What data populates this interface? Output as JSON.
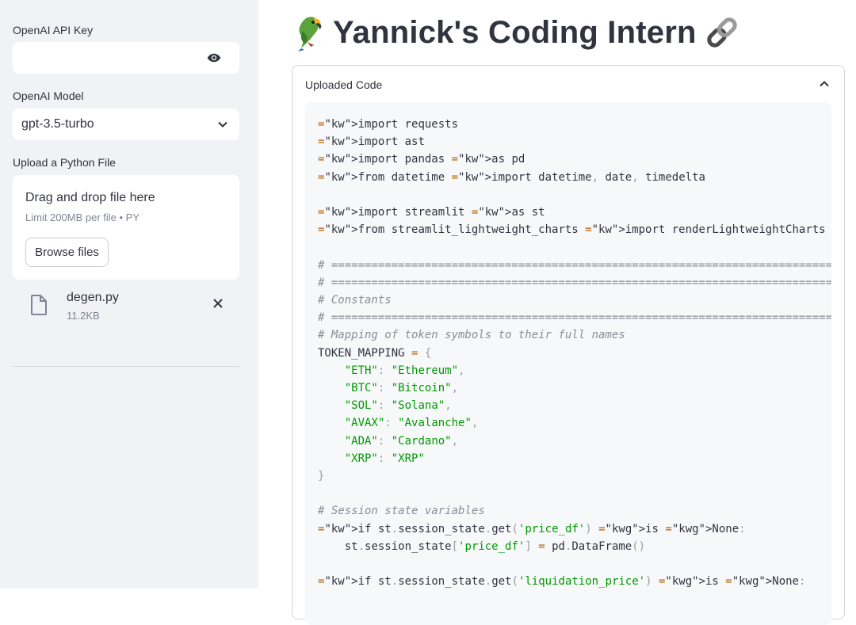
{
  "sidebar": {
    "api_key_label": "OpenAI API Key",
    "api_key_value": "",
    "model_label": "OpenAI Model",
    "model_value": "gpt-3.5-turbo",
    "upload_label": "Upload a Python File",
    "dropzone_title": "Drag and drop file here",
    "dropzone_limit": "Limit 200MB per file • PY",
    "browse_label": "Browse files",
    "file_name": "degen.py",
    "file_size": "11.2KB"
  },
  "main": {
    "title": "Yannick's Coding Intern",
    "title_icon_left": "parrot-icon",
    "title_icon_right": "link-icon",
    "expander_label": "Uploaded Code"
  },
  "code_lines": [
    "import requests",
    "import ast",
    "import pandas as pd",
    "from datetime import datetime, date, timedelta",
    "",
    "import streamlit as st",
    "from streamlit_lightweight_charts import renderLightweightCharts",
    "",
    "# ==========================================================================================",
    "# ==========================================================================================",
    "# Constants",
    "# ==========================================================================================",
    "# Mapping of token symbols to their full names",
    "TOKEN_MAPPING = {",
    "    \"ETH\": \"Ethereum\",",
    "    \"BTC\": \"Bitcoin\",",
    "    \"SOL\": \"Solana\",",
    "    \"AVAX\": \"Avalanche\",",
    "    \"ADA\": \"Cardano\",",
    "    \"XRP\": \"XRP\"",
    "}",
    "",
    "# Session state variables",
    "if st.session_state.get('price_df') is None:",
    "    st.session_state['price_df'] = pd.DataFrame()",
    "",
    "if st.session_state.get('liquidation_price') is None:"
  ]
}
